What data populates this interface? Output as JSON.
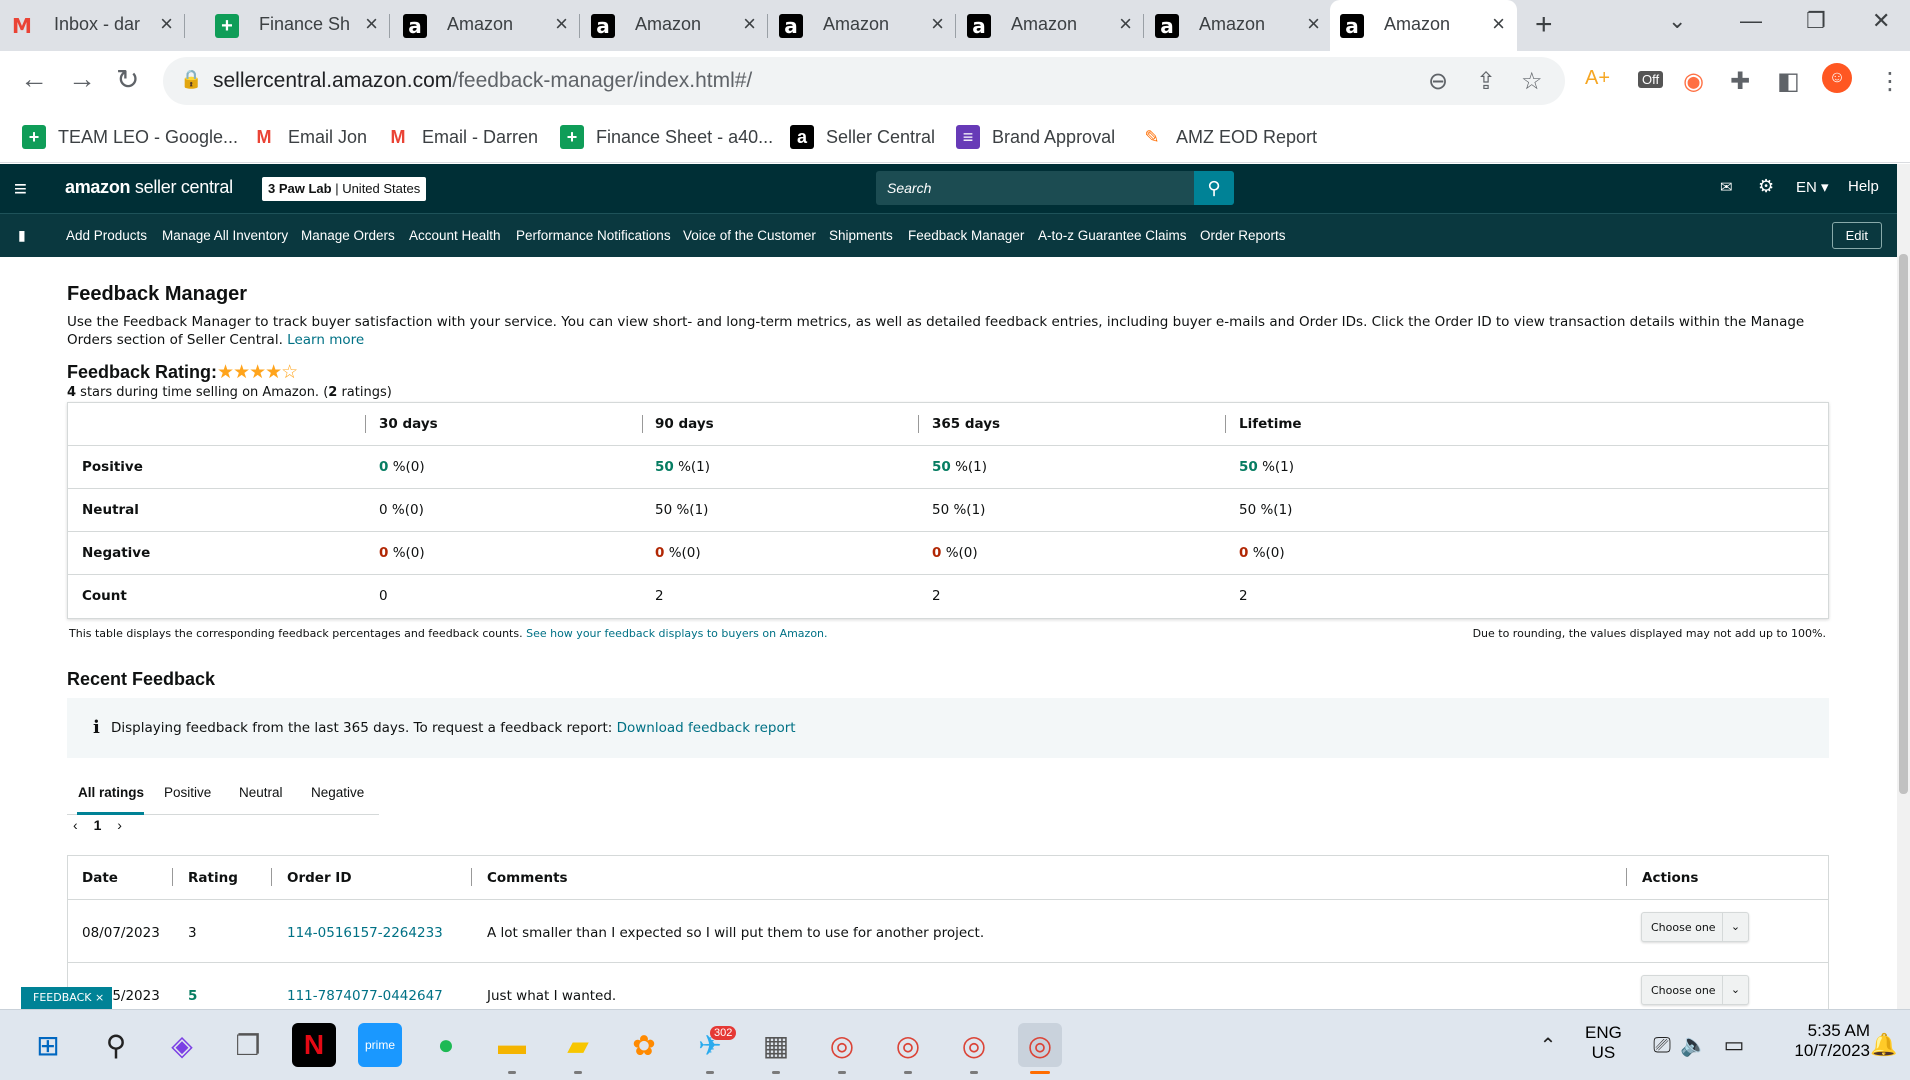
{
  "browser": {
    "tabs": [
      {
        "title": "Inbox - dar",
        "icon": "gmail-icon"
      },
      {
        "title": "Finance Sh",
        "icon": "sheets-icon"
      },
      {
        "title": "Amazon",
        "icon": "amazon-icon"
      },
      {
        "title": "Amazon",
        "icon": "amazon-icon"
      },
      {
        "title": "Amazon",
        "icon": "amazon-icon"
      },
      {
        "title": "Amazon",
        "icon": "amazon-icon"
      },
      {
        "title": "Amazon",
        "icon": "amazon-icon"
      },
      {
        "title": "Amazon",
        "icon": "amazon-icon",
        "active": true
      }
    ],
    "url_host": "sellercentral.amazon.com",
    "url_path": "/feedback-manager/index.html#/",
    "extension_badge": "Off",
    "bookmarks": [
      {
        "label": "TEAM LEO - Google...",
        "icon": "sheets-icon"
      },
      {
        "label": "Email Jon",
        "icon": "gmail-icon"
      },
      {
        "label": "Email - Darren",
        "icon": "gmail-icon"
      },
      {
        "label": "Finance Sheet - a40...",
        "icon": "sheets-icon"
      },
      {
        "label": "Seller Central",
        "icon": "amazon-icon"
      },
      {
        "label": "Brand Approval",
        "icon": "forms-icon"
      },
      {
        "label": "AMZ EOD Report",
        "icon": "report-icon"
      }
    ]
  },
  "header": {
    "logo_brand": "amazon",
    "logo_product": "seller central",
    "store_name": "3 Paw Lab",
    "store_region": "United States",
    "search_placeholder": "Search",
    "language": "EN",
    "help": "Help",
    "nav": [
      "Add Products",
      "Manage All Inventory",
      "Manage Orders",
      "Account Health",
      "Performance Notifications",
      "Voice of the Customer",
      "Shipments",
      "Feedback Manager",
      "A-to-z Guarantee Claims",
      "Order Reports"
    ],
    "edit": "Edit"
  },
  "page": {
    "title": "Feedback Manager",
    "description": "Use the Feedback Manager to track buyer satisfaction with your service. You can view short- and long-term metrics, as well as detailed feedback entries, including buyer e-mails and Order IDs. Click the Order ID to view transaction details within the Manage Orders section of Seller Central.",
    "learn_more": "Learn more",
    "rating_label": "Feedback Rating:",
    "rating_stars": 4,
    "rating_stars_max": 5,
    "rating_sub_value": "4",
    "rating_sub_text": " stars during time selling on Amazon. (",
    "rating_sub_count": "2",
    "rating_sub_end": " ratings)",
    "metrics": {
      "columns": [
        "30 days",
        "90 days",
        "365 days",
        "Lifetime"
      ],
      "rows": [
        {
          "label": "Positive",
          "cells": [
            {
              "pct": "0",
              "rest": " %(0)"
            },
            {
              "pct": "50",
              "rest": " %(1)"
            },
            {
              "pct": "50",
              "rest": " %(1)"
            },
            {
              "pct": "50",
              "rest": " %(1)"
            }
          ]
        },
        {
          "label": "Neutral",
          "cells": [
            {
              "pct": "0",
              "rest": " %(0)"
            },
            {
              "pct": "50",
              "rest": " %(1)"
            },
            {
              "pct": "50",
              "rest": " %(1)"
            },
            {
              "pct": "50",
              "rest": " %(1)"
            }
          ]
        },
        {
          "label": "Negative",
          "cells": [
            {
              "pct": "0",
              "rest": " %(0)"
            },
            {
              "pct": "0",
              "rest": " %(0)"
            },
            {
              "pct": "0",
              "rest": " %(0)"
            },
            {
              "pct": "0",
              "rest": " %(0)"
            }
          ]
        },
        {
          "label": "Count",
          "cells": [
            {
              "pct": "0",
              "rest": ""
            },
            {
              "pct": "2",
              "rest": ""
            },
            {
              "pct": "2",
              "rest": ""
            },
            {
              "pct": "2",
              "rest": ""
            }
          ]
        }
      ]
    },
    "note_left": "This table displays the corresponding feedback percentages and feedback counts.",
    "note_left_link": "See how your feedback displays to buyers on Amazon.",
    "note_right": "Due to rounding, the values displayed may not add up to 100%.",
    "recent_title": "Recent Feedback",
    "info_text": "Displaying feedback from the last 365 days. To request a feedback report:",
    "info_link": "Download feedback report",
    "filter_tabs": [
      "All ratings",
      "Positive",
      "Neutral",
      "Negative"
    ],
    "page_number": "1",
    "feedback_columns": [
      "Date",
      "Rating",
      "Order ID",
      "Comments",
      "Actions"
    ],
    "feedback_rows": [
      {
        "date": "08/07/2023",
        "rating": "3",
        "order_id": "114-0516157-2264233",
        "comment": "A lot smaller than I expected so I will put them to use for another project.",
        "action": "Choose one"
      },
      {
        "date": "07/15/2023",
        "rating": "5",
        "order_id": "111-7874077-0442647",
        "comment": "Just what I wanted.",
        "action": "Choose one"
      }
    ],
    "feedback_tab": "FEEDBACK"
  },
  "taskbar": {
    "telegram_badge": "302",
    "input_lang": "ENG",
    "input_region": "US",
    "time": "5:35 AM",
    "date": "10/7/2023"
  },
  "colors": {
    "positive": "#067d62",
    "negative": "#b12704",
    "header": "#002f36",
    "nav": "#0a383f",
    "link": "#007185",
    "star": "#ffa41c"
  }
}
